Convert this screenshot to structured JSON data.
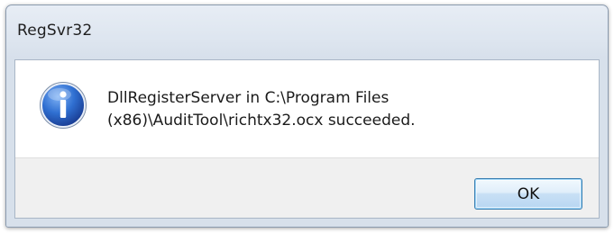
{
  "window": {
    "title": "RegSvr32"
  },
  "message": {
    "line1": "DllRegisterServer in C:\\Program Files",
    "line2": "(x86)\\AuditTool\\richtx32.ocx succeeded.",
    "icon": "information-icon"
  },
  "buttons": {
    "ok_label": "OK"
  },
  "colors": {
    "icon_blue": "#2b63c6",
    "button_border": "#3c7fb1",
    "footer_bg": "#f0f0f0"
  }
}
